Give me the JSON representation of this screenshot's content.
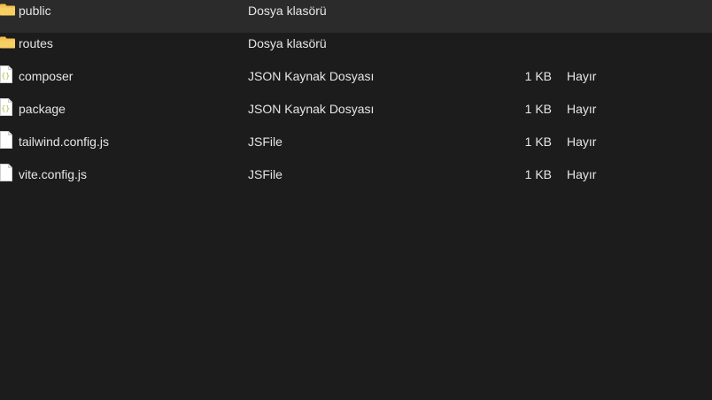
{
  "files": [
    {
      "name": "public",
      "type": "Dosya klasörü",
      "size": "",
      "availability": "",
      "icon": "folder-icon"
    },
    {
      "name": "routes",
      "type": "Dosya klasörü",
      "size": "",
      "availability": "",
      "icon": "folder-icon"
    },
    {
      "name": "composer",
      "type": "JSON Kaynak Dosyası",
      "size": "1 KB",
      "availability": "Hayır",
      "icon": "json-file-icon"
    },
    {
      "name": "package",
      "type": "JSON Kaynak Dosyası",
      "size": "1 KB",
      "availability": "Hayır",
      "icon": "json-file-icon"
    },
    {
      "name": "tailwind.config.js",
      "type": "JSFile",
      "size": "1 KB",
      "availability": "Hayır",
      "icon": "js-file-icon"
    },
    {
      "name": "vite.config.js",
      "type": "JSFile",
      "size": "1 KB",
      "availability": "Hayır",
      "icon": "js-file-icon"
    }
  ],
  "colors": {
    "background": "#1c1c1c",
    "text": "#e6e6e6",
    "folder": "#f2c14e",
    "json_accent": "#9bbf3b"
  }
}
